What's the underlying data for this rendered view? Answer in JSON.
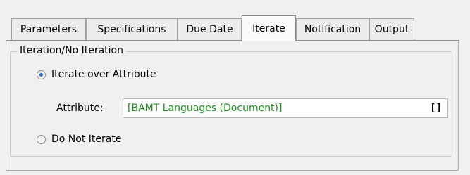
{
  "tabs": [
    {
      "label": "Parameters"
    },
    {
      "label": "Specifications"
    },
    {
      "label": "Due Date"
    },
    {
      "label": "Iterate",
      "active": true
    },
    {
      "label": "Notification"
    },
    {
      "label": "Output"
    }
  ],
  "group": {
    "legend": "Iteration/No Iteration",
    "iterate_option": {
      "label": "Iterate over Attribute",
      "checked": true
    },
    "attribute": {
      "label": "Attribute:",
      "value": "[BAMT Languages (Document)]",
      "button": "[]"
    },
    "no_iterate_option": {
      "label": "Do Not Iterate",
      "checked": false
    }
  },
  "colors": {
    "value_text": "#1e8e1e",
    "radio_dot": "#2f6fc0"
  }
}
